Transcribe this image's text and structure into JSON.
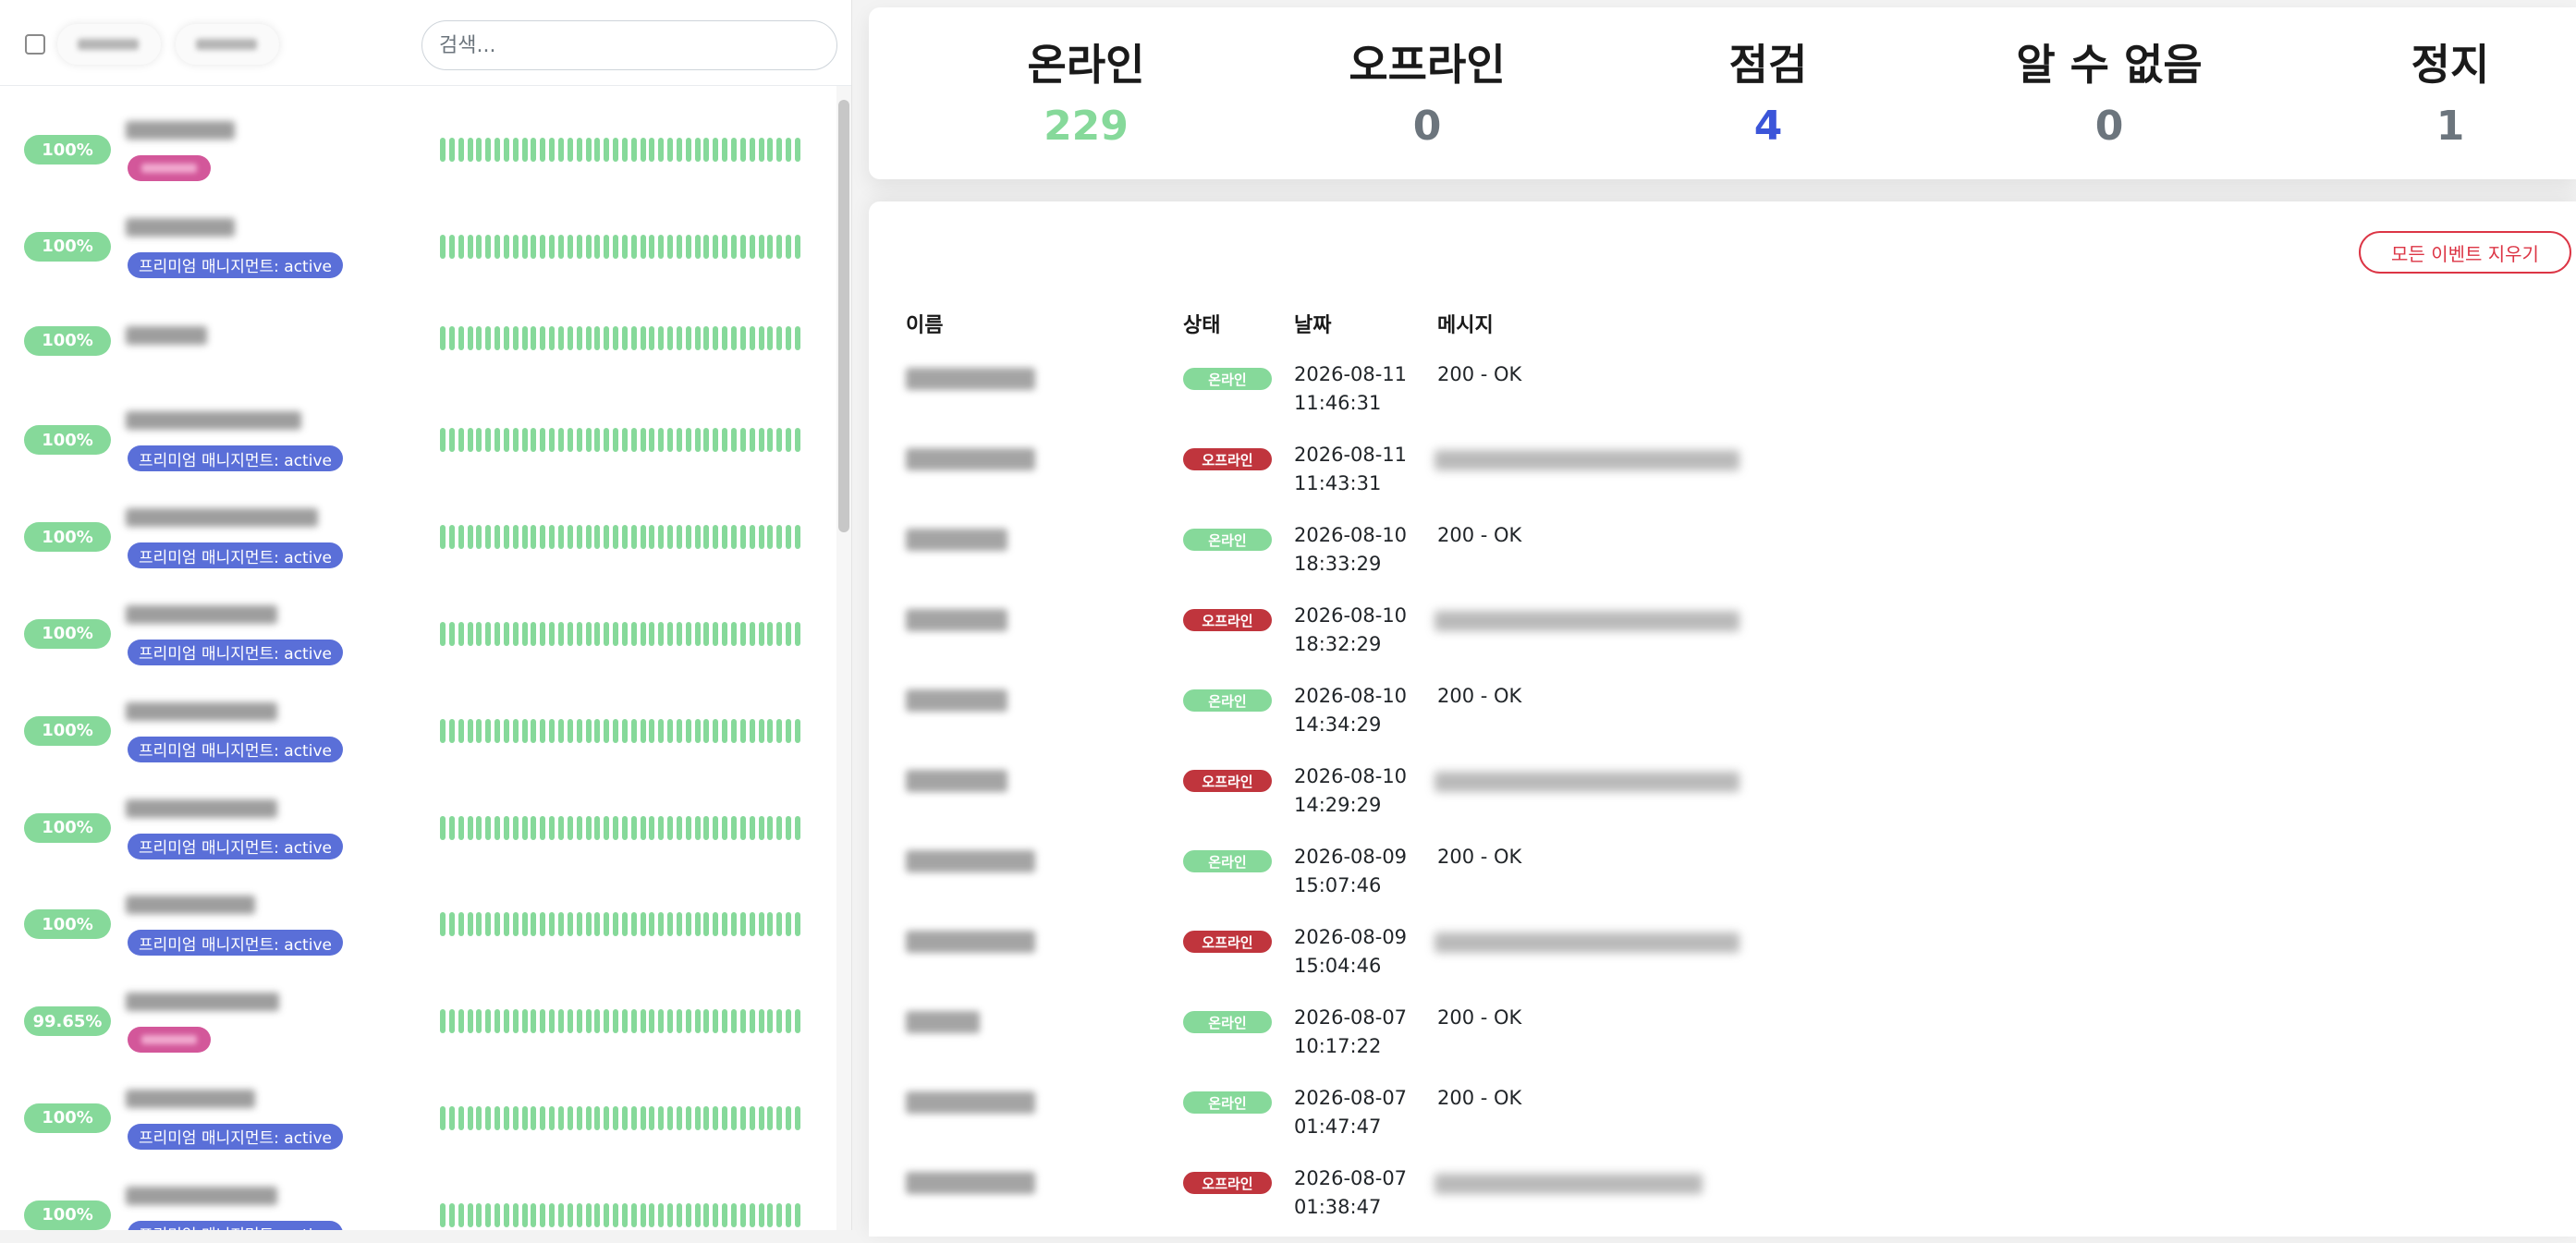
{
  "colors": {
    "up": "#86d99a",
    "down": "#c0353d",
    "maintenance": "#3b55d9",
    "neutral": "#6c757d",
    "tag_blue": "#5a6fd8",
    "tag_pink": "#d3579a",
    "danger": "#dc3545"
  },
  "search": {
    "placeholder": "검색..."
  },
  "monitors": [
    {
      "uptime": "100%",
      "tag": ""
    },
    {
      "uptime": "100%",
      "tag": "프리미엄 매니지먼트: active"
    },
    {
      "uptime": "100%",
      "tag": ""
    },
    {
      "uptime": "100%",
      "tag": "프리미엄 매니지먼트: active"
    },
    {
      "uptime": "100%",
      "tag": "프리미엄 매니지먼트: active"
    },
    {
      "uptime": "100%",
      "tag": "프리미엄 매니지먼트: active"
    },
    {
      "uptime": "100%",
      "tag": "프리미엄 매니지먼트: active"
    },
    {
      "uptime": "100%",
      "tag": "프리미엄 매니지먼트: active"
    },
    {
      "uptime": "100%",
      "tag": "프리미엄 매니지먼트: active"
    },
    {
      "uptime": "99.65%",
      "tag": ""
    },
    {
      "uptime": "100%",
      "tag": "프리미엄 매니지먼트: active"
    },
    {
      "uptime": "100%",
      "tag": "프리미엄 매니지먼트: active"
    }
  ],
  "stats": {
    "online": {
      "label": "온라인",
      "value": "229"
    },
    "offline": {
      "label": "오프라인",
      "value": "0"
    },
    "maintenance": {
      "label": "점검",
      "value": "4"
    },
    "unknown": {
      "label": "알 수 없음",
      "value": "0"
    },
    "paused": {
      "label": "정지",
      "value": "1"
    }
  },
  "events": {
    "clear_label": "모든 이벤트 지우기",
    "columns": {
      "name": "이름",
      "status": "상태",
      "date": "날짜",
      "message": "메시지"
    },
    "rows": [
      {
        "status": "온라인",
        "state": "up",
        "date": "2026-08-11",
        "time": "11:46:31",
        "message": "200 - OK"
      },
      {
        "status": "오프라인",
        "state": "down",
        "date": "2026-08-11",
        "time": "11:43:31",
        "message": ""
      },
      {
        "status": "온라인",
        "state": "up",
        "date": "2026-08-10",
        "time": "18:33:29",
        "message": "200 - OK"
      },
      {
        "status": "오프라인",
        "state": "down",
        "date": "2026-08-10",
        "time": "18:32:29",
        "message": ""
      },
      {
        "status": "온라인",
        "state": "up",
        "date": "2026-08-10",
        "time": "14:34:29",
        "message": "200 - OK"
      },
      {
        "status": "오프라인",
        "state": "down",
        "date": "2026-08-10",
        "time": "14:29:29",
        "message": ""
      },
      {
        "status": "온라인",
        "state": "up",
        "date": "2026-08-09",
        "time": "15:07:46",
        "message": "200 - OK"
      },
      {
        "status": "오프라인",
        "state": "down",
        "date": "2026-08-09",
        "time": "15:04:46",
        "message": ""
      },
      {
        "status": "온라인",
        "state": "up",
        "date": "2026-08-07",
        "time": "10:17:22",
        "message": "200 - OK"
      },
      {
        "status": "온라인",
        "state": "up",
        "date": "2026-08-07",
        "time": "01:47:47",
        "message": "200 - OK"
      },
      {
        "status": "오프라인",
        "state": "down",
        "date": "2026-08-07",
        "time": "01:38:47",
        "message": ""
      }
    ]
  }
}
